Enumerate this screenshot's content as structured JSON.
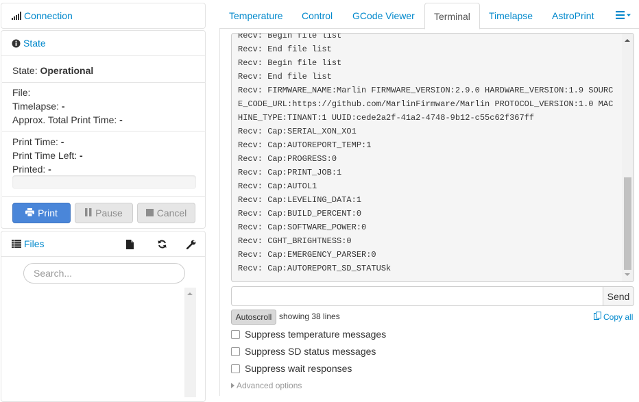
{
  "sidebar": {
    "connection": {
      "title": "Connection",
      "icon": "signal-icon"
    },
    "state": {
      "title": "State",
      "icon": "info-circle-icon",
      "state_label": "State:",
      "state_value": "Operational",
      "file_label": "File:",
      "file_value": "",
      "timelapse_label": "Timelapse:",
      "timelapse_value": "-",
      "approx_label": "Approx. Total Print Time:",
      "approx_value": "-",
      "print_time_label": "Print Time:",
      "print_time_value": "-",
      "print_time_left_label": "Print Time Left:",
      "print_time_left_value": "-",
      "printed_label": "Printed:",
      "printed_value": "-",
      "progress": 0,
      "buttons": {
        "print": "Print",
        "pause": "Pause",
        "cancel": "Cancel"
      }
    },
    "files": {
      "title": "Files",
      "icon": "list-icon",
      "tools": [
        "file-icon",
        "refresh-icon",
        "wrench-icon"
      ],
      "search_placeholder": "Search..."
    }
  },
  "tabs": [
    {
      "label": "Temperature",
      "active": false
    },
    {
      "label": "Control",
      "active": false
    },
    {
      "label": "GCode Viewer",
      "active": false
    },
    {
      "label": "Terminal",
      "active": true
    },
    {
      "label": "Timelapse",
      "active": false
    },
    {
      "label": "AstroPrint",
      "active": false
    }
  ],
  "terminal": {
    "lines": [
      "Recv: Begin file list",
      "Recv: End file list",
      "Recv: Begin file list",
      "Recv: End file list",
      "Recv: FIRMWARE_NAME:Marlin FIRMWARE_VERSION:2.9.0 HARDWARE_VERSION:1.9 SOURC",
      "E_CODE_URL:https://github.com/MarlinFirmware/Marlin PROTOCOL_VERSION:1.0 MAC",
      "HINE_TYPE:TINANT:1 UUID:cede2a2f-41a2-4748-9b12-c55c62f367ff",
      "Recv: Cap:SERIAL_XON_XO1",
      "Recv: Cap:AUTOREPORT_TEMP:1",
      "Recv: Cap:PROGRESS:0",
      "Recv: Cap:PRINT_JOB:1",
      "Recv: Cap:AUTOL1",
      "Recv: Cap:LEVELING_DATA:1",
      "Recv: Cap:BUILD_PERCENT:0",
      "Recv: Cap:SOFTWARE_POWER:0",
      "Recv: CGHT_BRIGHTNESS:0",
      "Recv: Cap:EMERGENCY_PARSER:0",
      "Recv: Cap:AUTOREPORT_SD_STATUSk"
    ],
    "command_value": "",
    "send_label": "Send",
    "autoscroll_label": "Autoscroll",
    "showing_text": "showing 38 lines",
    "copy_all_label": "Copy all",
    "options": [
      {
        "label": "Suppress temperature messages",
        "checked": false
      },
      {
        "label": "Suppress SD status messages",
        "checked": false
      },
      {
        "label": "Suppress wait responses",
        "checked": false
      }
    ],
    "advanced_label": "Advanced options"
  },
  "colors": {
    "link": "#0088cc",
    "print_button": "#4a86d9",
    "terminal_bg": "#f5f5f5"
  }
}
